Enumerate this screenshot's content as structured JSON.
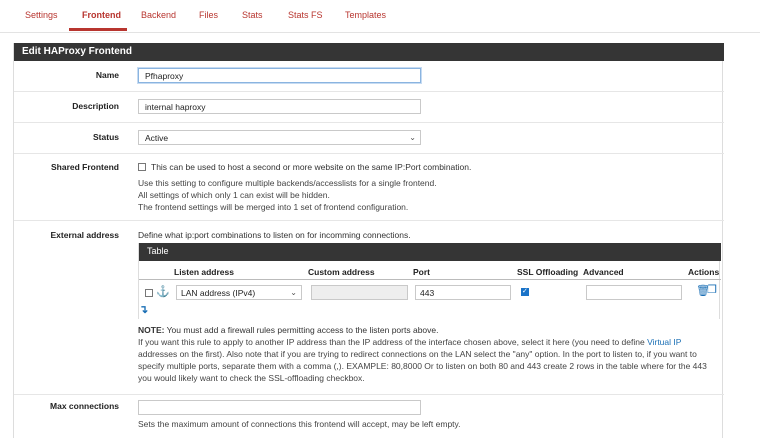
{
  "tabs": [
    {
      "label": "Settings"
    },
    {
      "label": "Frontend"
    },
    {
      "label": "Backend"
    },
    {
      "label": "Files"
    },
    {
      "label": "Stats"
    },
    {
      "label": "Stats FS"
    },
    {
      "label": "Templates"
    }
  ],
  "active_tab": "Frontend",
  "panel": {
    "title": "Edit HAProxy Frontend"
  },
  "name": {
    "label": "Name",
    "value": "Pfhaproxy"
  },
  "description": {
    "label": "Description",
    "value": "internal haproxy"
  },
  "status": {
    "label": "Status",
    "value": "Active"
  },
  "shared": {
    "label": "Shared Frontend",
    "checkbox_text": "This can be used to host a second or more website on the same IP:Port combination.",
    "help1": "Use this setting to configure multiple backends/accesslists for a single frontend.",
    "help2": "All settings of which only 1 can exist will be hidden.",
    "help3": "The frontend settings will be merged into 1 set of frontend configuration."
  },
  "external": {
    "label": "External address",
    "intro": "Define what ip:port combinations to listen on for incomming connections.",
    "table_title": "Table",
    "columns": {
      "listen": "Listen address",
      "custom": "Custom address",
      "port": "Port",
      "ssl": "SSL Offloading",
      "advanced": "Advanced",
      "actions": "Actions"
    },
    "row": {
      "listen_value": "LAN address (IPv4)",
      "custom_value": "",
      "port_value": "443",
      "ssl_checked": true,
      "advanced_value": ""
    },
    "note_bold": "NOTE:",
    "note_rest": " You must add a firewall rules permitting access to the listen ports above.",
    "p1": "If you want this rule to apply to another IP address than the IP address of the interface chosen above, select it here (you need to define",
    "p1_link": "Virtual IP",
    "p2": "addresses on the first). Also note that if you are trying to redirect connections on the LAN select the \"any\" option. In the port to listen to, if you want to",
    "p3": "specify multiple ports, separate them with a comma (,). EXAMPLE: 80,8000 Or to listen on both 80 and 443 create 2 rows in the table where for the 443",
    "p4": "you would likely want to check the SSL-offloading checkbox."
  },
  "maxconn": {
    "label": "Max connections",
    "value": "",
    "help": "Sets the maximum amount of connections this frontend will accept, may be left empty."
  },
  "colors": {
    "accent": "#b8352f",
    "header": "#353535",
    "link": "#1a6fb5"
  }
}
